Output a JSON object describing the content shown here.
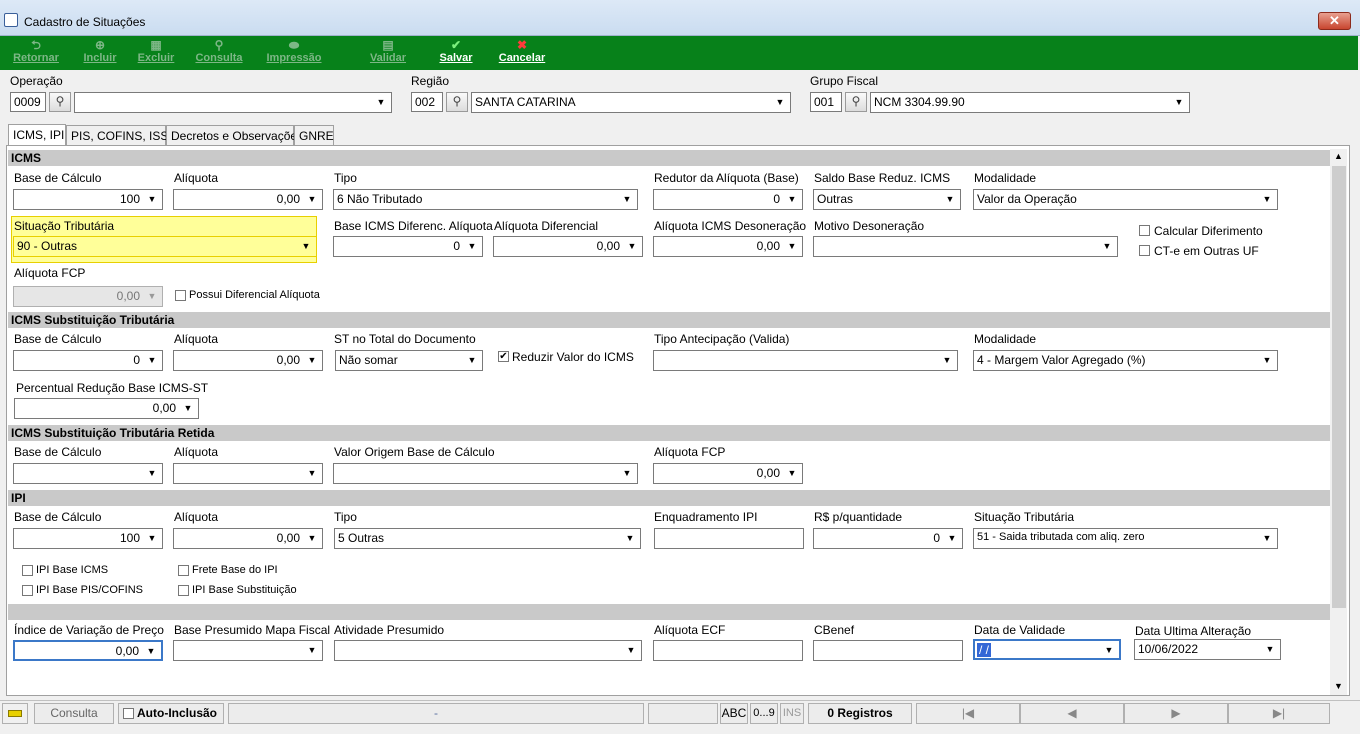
{
  "window": {
    "title": "Cadastro de Situações",
    "close": "✕"
  },
  "toolbar": {
    "retornar": "Retornar",
    "incluir": "Incluir",
    "excluir": "Excluir",
    "consulta": "Consulta",
    "impressao": "Impressão",
    "validar": "Validar",
    "salvar": "Salvar",
    "cancelar": "Cancelar"
  },
  "header": {
    "operacao": {
      "label": "Operação",
      "code": "0009",
      "value": ""
    },
    "regiao": {
      "label": "Região",
      "code": "002",
      "value": "SANTA CATARINA"
    },
    "grupo": {
      "label": "Grupo Fiscal",
      "code": "001",
      "value": "NCM 3304.99.90"
    }
  },
  "tabs": [
    "ICMS, IPI",
    "PIS, COFINS, ISS",
    "Decretos e Observações",
    "GNRE"
  ],
  "icms": {
    "title": "ICMS",
    "base_label": "Base de Cálculo",
    "base_value": "100",
    "aliq_label": "Alíquota",
    "aliq_value": "0,00",
    "tipo_label": "Tipo",
    "tipo_value": "6 Não Tributado",
    "redutor_label": "Redutor da Alíquota (Base)",
    "redutor_value": "0",
    "saldo_label": "Saldo Base Reduz. ICMS",
    "saldo_value": "Outras",
    "modal_label": "Modalidade",
    "modal_value": "Valor da Operação",
    "sit_label": "Situação Tributária",
    "sit_value": "90 - Outras",
    "bdif_label": "Base ICMS Diferenc. Alíquota",
    "bdif_value": "0",
    "adif_label": "Alíquota Diferencial",
    "adif_value": "0,00",
    "ades_label": "Alíquota ICMS Desoneração",
    "ades_value": "0,00",
    "mdes_label": "Motivo Desoneração",
    "mdes_value": "",
    "calc_dif": "Calcular Diferimento",
    "cte": "CT-e em Outras UF",
    "fcp_label": "Alíquota FCP",
    "fcp_value": "0,00",
    "possui": "Possui Diferencial Alíquota"
  },
  "st": {
    "title": "ICMS Substituição Tributária",
    "base_label": "Base de Cálculo",
    "base_value": "0",
    "aliq_label": "Alíquota",
    "aliq_value": "0,00",
    "total_label": "ST no Total do Documento",
    "total_value": "Não somar",
    "reduzir": "Reduzir Valor do ICMS",
    "antec_label": "Tipo Antecipação (Valida)",
    "antec_value": "",
    "modal_label": "Modalidade",
    "modal_value": "4 - Margem Valor Agregado (%)",
    "perc_label": "Percentual Redução Base ICMS-ST",
    "perc_value": "0,00"
  },
  "str": {
    "title": "ICMS Substituição Tributária Retida",
    "base_label": "Base de Cálculo",
    "aliq_label": "Alíquota",
    "origem_label": "Valor Origem Base de Cálculo",
    "fcp_label": "Alíquota FCP",
    "fcp_value": "0,00"
  },
  "ipi": {
    "title": "IPI",
    "base_label": "Base de Cálculo",
    "base_value": "100",
    "aliq_label": "Alíquota",
    "aliq_value": "0,00",
    "tipo_label": "Tipo",
    "tipo_value": "5 Outras",
    "enq_label": "Enquadramento IPI",
    "rsq_label": "R$ p/quantidade",
    "rsq_value": "0",
    "sit_label": "Situação Tributária",
    "sit_value": "51 - Saida tributada com aliq. zero",
    "c1": "IPI Base ICMS",
    "c2": "Frete Base do IPI",
    "c3": "IPI Base PIS/COFINS",
    "c4": "IPI Base Substituição"
  },
  "bottom": {
    "ind_label": "Índice de Variação de Preço",
    "ind_value": "0,00",
    "bpm_label": "Base Presumido Mapa Fiscal",
    "ativ_label": "Atividade Presumido",
    "ecf_label": "Alíquota ECF",
    "cbenef_label": "CBenef",
    "val_label": "Data de Validade",
    "val_value": " / /",
    "ult_label": "Data Ultima Alteração",
    "ult_value": "10/06/2022"
  },
  "statusbar": {
    "consulta": "Consulta",
    "auto": "Auto-Inclusão",
    "dash": "-",
    "abc": "ABC",
    "num": "0...9",
    "ins": "INS",
    "registros": "0 Registros"
  },
  "colors": {
    "toolbar": "#07811a",
    "highlight": "#ffff99",
    "section": "#c9c9c9"
  }
}
